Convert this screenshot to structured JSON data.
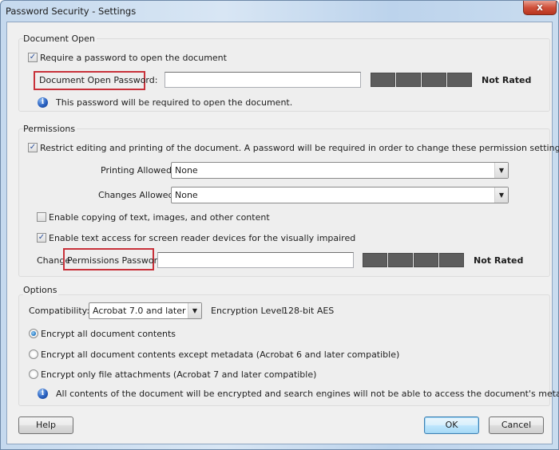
{
  "window": {
    "title": "Password Security - Settings",
    "close_glyph": "x"
  },
  "document_open": {
    "group_title": "Document Open",
    "require_password": {
      "label": "Require a password to open the document",
      "checked": true,
      "mark": "✓"
    },
    "password_label": "Document Open Password:",
    "password_value": "",
    "strength_rating": "Not Rated",
    "info_text": "This password will be required to open the document.",
    "info_glyph": "i"
  },
  "permissions": {
    "group_title": "Permissions",
    "restrict": {
      "label": "Restrict editing and printing of the document. A password will be required in order to change these permission settings.",
      "checked": true,
      "mark": "✓"
    },
    "printing_allowed": {
      "label": "Printing Allowed:",
      "value": "None"
    },
    "changes_allowed": {
      "label": "Changes Allowed:",
      "value": "None"
    },
    "enable_copying": {
      "label": "Enable copying of text, images, and other content",
      "checked": false,
      "mark": ""
    },
    "enable_screen_reader": {
      "label": "Enable text access for screen reader devices for the visually impaired",
      "checked": true,
      "mark": "✓"
    },
    "change_prefix": "Change",
    "password_label": "Permissions Password:",
    "password_value": "",
    "strength_rating": "Not Rated",
    "dropdown_glyph": "▼"
  },
  "options": {
    "group_title": "Options",
    "compatibility_label": "Compatibility:",
    "compatibility_value": "Acrobat 7.0 and later",
    "encryption_label": "Encryption  Level:",
    "encryption_value": "128-bit AES",
    "radios": [
      {
        "label": "Encrypt all document contents",
        "selected": true
      },
      {
        "label": "Encrypt all document contents except metadata (Acrobat 6 and later compatible)",
        "selected": false
      },
      {
        "label": "Encrypt only file attachments (Acrobat 7 and later compatible)",
        "selected": false
      }
    ],
    "info_text": "All contents of the document will be encrypted and search engines will not be able to access the document's metadata.",
    "info_glyph": "i"
  },
  "buttons": {
    "help": "Help",
    "ok": "OK",
    "cancel": "Cancel"
  }
}
